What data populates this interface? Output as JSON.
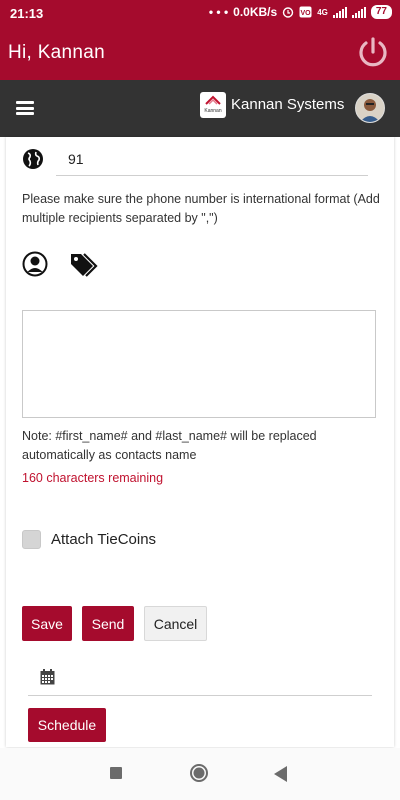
{
  "status_bar": {
    "time": "21:13",
    "dots": "• • •",
    "speed": "0.0KB/s",
    "network": "4G",
    "battery": "77"
  },
  "header": {
    "greeting": "Hi, Kannan"
  },
  "navbar": {
    "company": "Kannan Systems",
    "logo_text": "Kannan"
  },
  "form": {
    "country_code": "91",
    "phone_hint": "Please make sure the phone number is international format (Add multiple recipients separated by \",\")",
    "message_value": "",
    "note": "Note: #first_name# and #last_name# will be replaced automatically as contacts name",
    "chars_remaining": "160 characters remaining",
    "attach_label": "Attach TieCoins",
    "attach_checked": false,
    "schedule_date_value": ""
  },
  "buttons": {
    "save": "Save",
    "send": "Send",
    "cancel": "Cancel",
    "schedule": "Schedule"
  },
  "colors": {
    "brand": "#a50b2d",
    "navbar": "#333333",
    "warning_text": "#c0122f"
  }
}
